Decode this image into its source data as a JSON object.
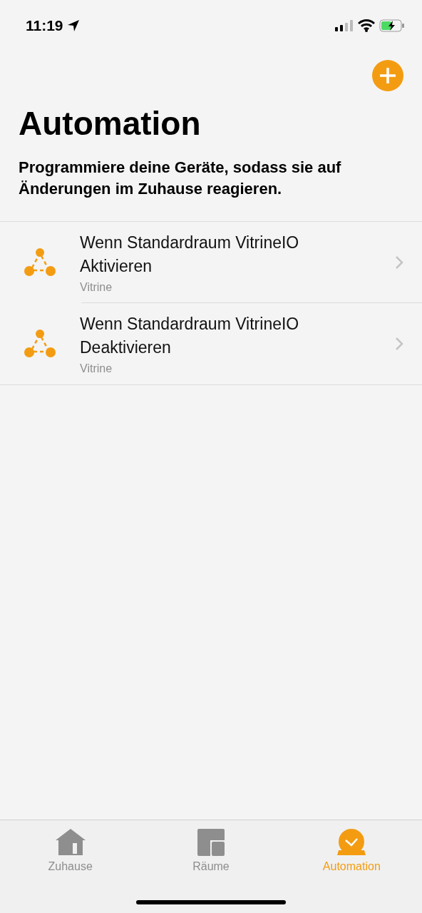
{
  "status_bar": {
    "time": "11:19"
  },
  "title": "Automation",
  "subtitle": "Programmiere deine Geräte, sodass sie auf Änderungen im Zuhause reagieren.",
  "automations": [
    {
      "title": "Wenn Standardraum VitrineIO Aktivieren",
      "subtitle": "Vitrine"
    },
    {
      "title": "Wenn Standardraum VitrineIO Deaktivieren",
      "subtitle": "Vitrine"
    }
  ],
  "tabs": [
    {
      "kind": "home",
      "label": "Zuhause",
      "selected": false
    },
    {
      "kind": "rooms",
      "label": "Räume",
      "selected": false
    },
    {
      "kind": "automation",
      "label": "Automation",
      "selected": true
    }
  ]
}
